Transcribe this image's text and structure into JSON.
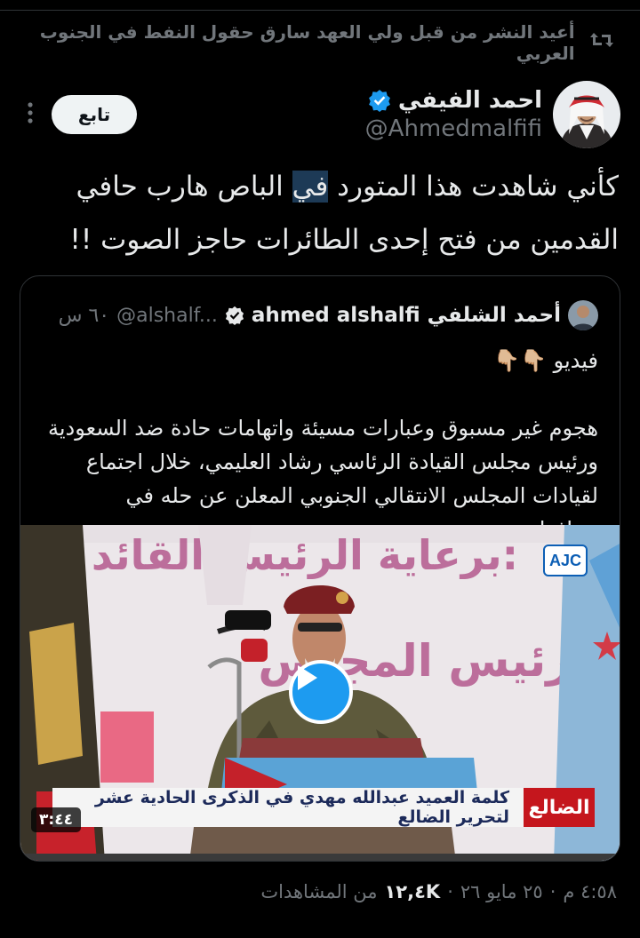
{
  "retweet": {
    "icon": "retweet-icon",
    "text": "أعيد النشر من قبل ولي العهد سارق حقول النفط في الجنوب العربي"
  },
  "author": {
    "name": "احمد الفيفي",
    "handle": "@Ahmedmalfifi",
    "verified": true,
    "follow_label": "تابع",
    "more_icon": "more-vertical-icon"
  },
  "tweet": {
    "text_before": "كأني شاهدت هذا المتورد ",
    "text_highlight": "في",
    "text_after": " الباص هارب حافي القدمين من فتح إحدى الطائرات حاجز الصوت !!"
  },
  "quoted": {
    "name": "أحمد الشلفي ahmed alshalfi",
    "handle": "@alshalf...",
    "time": "٦٠ س",
    "line1": "فيديو 👇🏼👇🏼",
    "line2": "هجوم غير مسبوق وعبارات مسيئة واتهامات حادة ضد السعودية ورئيس مجلس القيادة الرئاسي رشاد العليمي، خلال اجتماع لقيادات المجلس الانتقالي الجنوبي المعلن عن حله في محافظة..."
  },
  "video": {
    "channel_logo": "AJC",
    "caption_place": "الضالع",
    "caption_title": "كلمة العميد عبدالله مهدي في الذكرى الحادية عشر لتحرير الضالع",
    "duration": "٣:٤٤",
    "play_icon": "play-icon",
    "banner_text_top": "برعاية الرئيس القائد:",
    "banner_text_mid": "رئيس المجلس"
  },
  "meta": {
    "time": "٤:٥٨ م",
    "date": "٢٥ مايو ٢٦",
    "views_count": "١٢,٤K",
    "views_label": "من المشاهدات",
    "separator": "·"
  },
  "colors": {
    "background": "#000000",
    "text": "#e7e9ea",
    "secondary": "#71767b",
    "accent": "#1d9bf0",
    "highlight": "#1d3a56"
  }
}
